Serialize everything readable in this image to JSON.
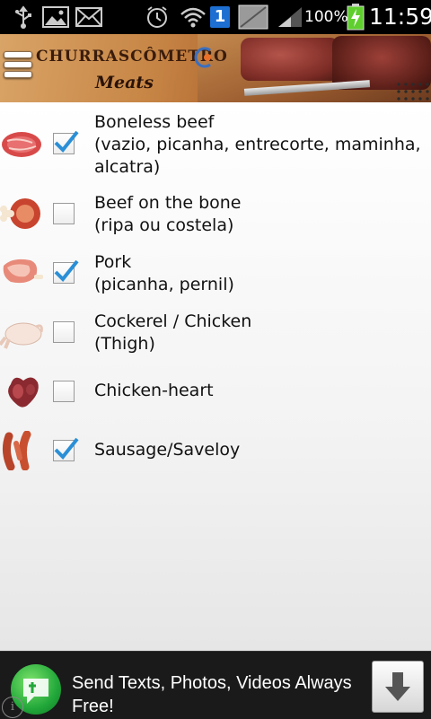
{
  "status_bar": {
    "battery_text": "100%",
    "time": "11:59",
    "sim_slot": "1",
    "icons": [
      "usb-icon",
      "gallery-icon",
      "mail-icon",
      "alarm-icon",
      "wifi-icon",
      "sim-icon",
      "no-signal-icon",
      "signal-icon",
      "battery-charging-icon"
    ]
  },
  "header": {
    "app_title": "CHURRASCÔMETRO",
    "screen_title": "Meats",
    "menu_icon": "menu-icon"
  },
  "meats": [
    {
      "title": "Boneless beef",
      "detail_1": "(vazio, picanha, entrecorte, maminha,",
      "detail_2": "alcatra)",
      "checked": true,
      "icon": "beef-steak-icon"
    },
    {
      "title": "Beef on the bone",
      "detail_1": "(ripa ou costela)",
      "checked": false,
      "icon": "beef-bone-icon"
    },
    {
      "title": "Pork",
      "detail_1": "(picanha, pernil)",
      "checked": true,
      "icon": "pork-icon"
    },
    {
      "title": "Cockerel / Chicken",
      "detail_1": "(Thigh)",
      "checked": false,
      "icon": "chicken-icon"
    },
    {
      "title": "Chicken-heart",
      "checked": false,
      "icon": "chicken-heart-icon"
    },
    {
      "title": "Sausage/Saveloy",
      "checked": true,
      "icon": "sausage-icon"
    }
  ],
  "ad": {
    "text": "Send Texts, Photos, Videos Always Free!",
    "logo_icon": "textplus-logo-icon",
    "download_icon": "download-arrow-icon",
    "info_label": "i"
  },
  "colors": {
    "check_blue": "#2a8fd6",
    "header_wood": "#b36a32",
    "ad_bg": "#1a1a1a"
  }
}
